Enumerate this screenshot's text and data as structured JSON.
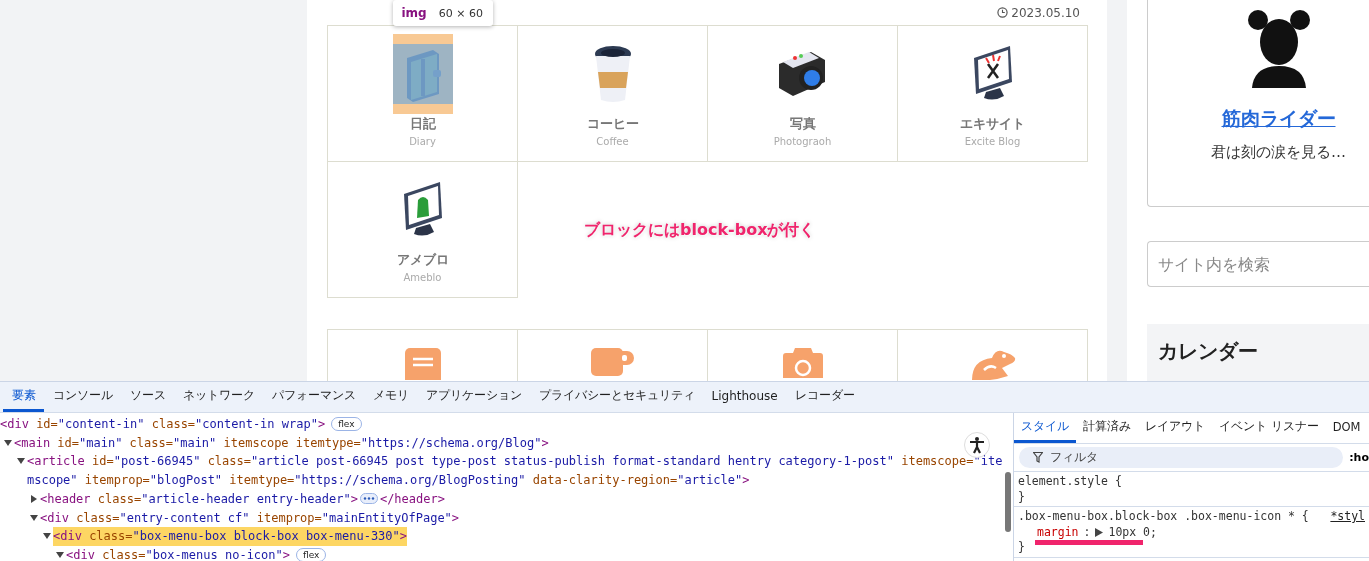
{
  "post_date": "2023.05.10",
  "inspector_tooltip": {
    "tag": "img",
    "size": "60 × 60"
  },
  "box_menu": [
    {
      "title": "日記",
      "subtitle": "Diary",
      "kind": "wallet",
      "inspected": true
    },
    {
      "title": "コーヒー",
      "subtitle": "Coffee",
      "kind": "coffee",
      "inspected": false
    },
    {
      "title": "写真",
      "subtitle": "Photograoh",
      "kind": "camera",
      "inspected": false
    },
    {
      "title": "エキサイト",
      "subtitle": "Excite Blog",
      "kind": "monitor-red",
      "inspected": false
    },
    {
      "title": "アメブロ",
      "subtitle": "Ameblo",
      "kind": "monitor-green",
      "inspected": false
    }
  ],
  "annotation": "ブロックにはblock-boxが付く",
  "second_menu": [
    {
      "kind": "memo"
    },
    {
      "kind": "mug"
    },
    {
      "kind": "camera"
    },
    {
      "kind": "bird"
    }
  ],
  "profile": {
    "name": "筋肉ライダー",
    "bio": "君は刻の涙を見る…"
  },
  "search": {
    "placeholder": "サイト内を検索"
  },
  "calendar_heading": "カレンダー",
  "devtools": {
    "tabs": [
      {
        "label": "要素",
        "selected": true
      },
      {
        "label": "コンソール",
        "selected": false
      },
      {
        "label": "ソース",
        "selected": false
      },
      {
        "label": "ネットワーク",
        "selected": false
      },
      {
        "label": "パフォーマンス",
        "selected": false
      },
      {
        "label": "メモリ",
        "selected": false
      },
      {
        "label": "アプリケーション",
        "selected": false
      },
      {
        "label": "プライバシーとセキュリティ",
        "selected": false
      },
      {
        "label": "Lighthouse",
        "selected": false
      },
      {
        "label": "レコーダー",
        "selected": false
      }
    ],
    "dom_tree": [
      {
        "selected": false,
        "parts": [
          {
            "kind": "markup",
            "tokens": [
              {
                "kind": "tag",
                "text": "<div"
              },
              {
                "kind": "attr",
                "text": " id="
              },
              {
                "kind": "value",
                "text": "\"content-in\""
              },
              {
                "kind": "attr",
                "text": " class="
              },
              {
                "kind": "value",
                "text": "\"content-in wrap\""
              },
              {
                "kind": "tag",
                "text": ">"
              }
            ]
          },
          {
            "kind": "badge",
            "text": "flex"
          }
        ]
      },
      {
        "expanded": true,
        "selected": false,
        "parts": [
          {
            "kind": "markup",
            "tokens": [
              {
                "kind": "tag",
                "text": "<main"
              },
              {
                "kind": "attr",
                "text": " id="
              },
              {
                "kind": "value",
                "text": "\"main\""
              },
              {
                "kind": "attr",
                "text": " class="
              },
              {
                "kind": "value",
                "text": "\"main\""
              },
              {
                "kind": "attr",
                "text": " itemscope itemtype="
              },
              {
                "kind": "value",
                "text": "\"https://schema.org/Blog\""
              },
              {
                "kind": "tag",
                "text": ">"
              }
            ]
          }
        ],
        "children": [
          {
            "expanded": true,
            "selected": false,
            "parts": [
              {
                "kind": "markup",
                "tokens": [
                  {
                    "kind": "tag",
                    "text": "<article"
                  },
                  {
                    "kind": "attr",
                    "text": " id="
                  },
                  {
                    "kind": "value",
                    "text": "\"post-66945\""
                  },
                  {
                    "kind": "attr",
                    "text": " class="
                  },
                  {
                    "kind": "value",
                    "text": "\"article post-66945 post type-post status-publish format-standard hentry category-1-post\""
                  },
                  {
                    "kind": "attr",
                    "text": " itemscope="
                  },
                  {
                    "kind": "value",
                    "text": "\"itemscope\""
                  },
                  {
                    "kind": "attr",
                    "text": " itemprop="
                  },
                  {
                    "kind": "value",
                    "text": "\"blogPost\""
                  },
                  {
                    "kind": "attr",
                    "text": " itemtype="
                  },
                  {
                    "kind": "value",
                    "text": "\"https://schema.org/BlogPosting\""
                  },
                  {
                    "kind": "attr",
                    "text": " data-clarity-region="
                  },
                  {
                    "kind": "value",
                    "text": "\"article\""
                  },
                  {
                    "kind": "tag",
                    "text": ">"
                  }
                ]
              }
            ],
            "children": [
              {
                "expanded": false,
                "selected": false,
                "parts": [
                  {
                    "kind": "markup",
                    "tokens": [
                      {
                        "kind": "tag",
                        "text": "<header"
                      },
                      {
                        "kind": "attr",
                        "text": " class="
                      },
                      {
                        "kind": "value",
                        "text": "\"article-header entry-header\""
                      },
                      {
                        "kind": "tag",
                        "text": ">"
                      }
                    ]
                  },
                  {
                    "kind": "ellipsis"
                  },
                  {
                    "kind": "markup",
                    "tokens": [
                      {
                        "kind": "tag",
                        "text": "</header>"
                      }
                    ]
                  }
                ]
              },
              {
                "expanded": true,
                "selected": false,
                "parts": [
                  {
                    "kind": "markup",
                    "tokens": [
                      {
                        "kind": "tag",
                        "text": "<div"
                      },
                      {
                        "kind": "attr",
                        "text": " class="
                      },
                      {
                        "kind": "value",
                        "text": "\"entry-content cf\""
                      },
                      {
                        "kind": "attr",
                        "text": " itemprop="
                      },
                      {
                        "kind": "value",
                        "text": "\"mainEntityOfPage\""
                      },
                      {
                        "kind": "tag",
                        "text": ">"
                      }
                    ]
                  }
                ],
                "children": [
                  {
                    "expanded": true,
                    "selected": true,
                    "parts": [
                      {
                        "kind": "markup",
                        "tokens": [
                          {
                            "kind": "tag",
                            "text": "<div"
                          },
                          {
                            "kind": "attr",
                            "text": " class="
                          },
                          {
                            "kind": "value",
                            "text": "\"box-menu-box block-box box-menu-330\""
                          },
                          {
                            "kind": "tag",
                            "text": ">"
                          }
                        ]
                      }
                    ],
                    "children": [
                      {
                        "expanded": true,
                        "selected": false,
                        "parts": [
                          {
                            "kind": "markup",
                            "tokens": [
                              {
                                "kind": "tag",
                                "text": "<div"
                              },
                              {
                                "kind": "attr",
                                "text": " class="
                              },
                              {
                                "kind": "value",
                                "text": "\"box-menus no-icon\""
                              },
                              {
                                "kind": "tag",
                                "text": ">"
                              }
                            ]
                          },
                          {
                            "kind": "badge",
                            "text": "flex"
                          }
                        ]
                      }
                    ]
                  }
                ]
              }
            ]
          }
        ]
      }
    ],
    "styles_tabs": [
      {
        "label": "スタイル",
        "selected": true
      },
      {
        "label": "計算済み",
        "selected": false
      },
      {
        "label": "レイアウト",
        "selected": false
      },
      {
        "label": "イベント リスナー",
        "selected": false
      },
      {
        "label": "DOM",
        "selected": false
      }
    ],
    "filter": {
      "placeholder": "フィルタ"
    },
    "state_toggle": ":ho",
    "rules": [
      {
        "selector_line": "element.style {",
        "closing": "}"
      },
      {
        "selector_line": ".box-menu-box.block-box .box-menu-icon * {",
        "source": "*styl",
        "declarations": [
          {
            "property": "margin",
            "separator": ":",
            "value": "10px 0;",
            "expandable": true,
            "underlined": true
          }
        ],
        "closing": "}"
      }
    ]
  }
}
